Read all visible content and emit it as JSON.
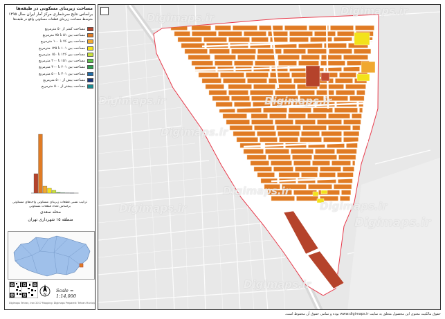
{
  "sidebar": {
    "title": "مساحت زیربنای مسکونی در طبقه‌ها",
    "subtitle": "براساس نتایج سرشماری مرکز آمار ایران سال ۱۳۹۵",
    "legend_title": "متوسط مساحت زیربنای قطعات مسکونی واقع در طبقه‌ها",
    "legend": [
      {
        "label": "مساحت کمتر از ۵۰ مترمربع",
        "color": "#b5432b"
      },
      {
        "label": "مساحت بین ۵۱ تا ۷۵ مترمربع",
        "color": "#e07b24"
      },
      {
        "label": "مساحت بین ۷۶ تا ۱۰۰ مترمربع",
        "color": "#f0a830"
      },
      {
        "label": "مساحت بین ۱۰۱ تا ۱۲۵ مترمربع",
        "color": "#f3e21a"
      },
      {
        "label": "مساحت بین ۱۲۶ تا ۱۵۰ مترمربع",
        "color": "#c9e23a"
      },
      {
        "label": "مساحت بین ۱۵۱ تا ۲۰۰ مترمربع",
        "color": "#5cc04a"
      },
      {
        "label": "مساحت بین ۲۰۱ تا ۳۰۰ مترمربع",
        "color": "#2f9e4f"
      },
      {
        "label": "مساحت بین ۳۰۱ تا ۵۰۰ مترمربع",
        "color": "#1f6ba8"
      },
      {
        "label": "مساحت بیش از ۵۰۰ مترمربع",
        "color": "#16327a"
      },
      {
        "label": "مساحت بیشتر از ۵۰۰ مترمربع",
        "color": "#1a8a8e"
      }
    ],
    "histogram_caption_1": "ترکیب نسبی قطعات زیربنای مسکونی واحدهای مسکونی",
    "histogram_caption_2": "براساس تعداد قطعات مسکونی",
    "region_1": "محله سعدی",
    "region_2": "منطقه ۱۵ شهرداری تهران",
    "scale": "Scale = 1:14,000",
    "credit": "Digimaps Tehran, Iran  2017  Mapping: Digimaps  Prepared: Tehran Municipality"
  },
  "chart_data": {
    "type": "bar",
    "categories": [
      "<50",
      "51-75",
      "76-100",
      "101-125",
      "126-150",
      "151-200",
      "201-300",
      "301-500",
      ">500"
    ],
    "values": [
      28,
      85,
      10,
      7,
      4,
      1,
      0.5,
      0.3,
      0.2
    ],
    "colors": [
      "#b5432b",
      "#e07b24",
      "#f0a830",
      "#f3e21a",
      "#c9e23a",
      "#5cc04a",
      "#2f9e4f",
      "#1f6ba8",
      "#16327a"
    ],
    "ylim": [
      0,
      100
    ],
    "xlabel": "",
    "ylabel": ""
  },
  "map": {
    "watermark": "Digimaps.ir",
    "footer": "حقوق مالکیت معنوی این محصول متعلق به سایت www.digimaps.ir بوده و تمامی حقوق آن محفوظ است."
  }
}
